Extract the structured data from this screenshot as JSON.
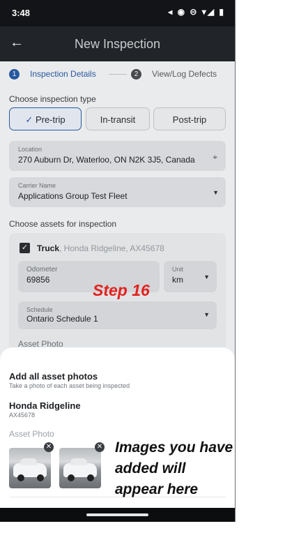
{
  "status_bar": {
    "time": "3:48",
    "icons": "◂ ◉ ⊝ ▾◢ ▮"
  },
  "app_bar": {
    "title": "New Inspection"
  },
  "stepper": {
    "step1_number": "1",
    "step1_label": "Inspection Details",
    "step2_number": "2",
    "step2_label": "View/Log Defects"
  },
  "inspection_type": {
    "label": "Choose inspection type",
    "options": [
      "Pre-trip",
      "In-transit",
      "Post-trip"
    ],
    "selected": "Pre-trip"
  },
  "location": {
    "label": "Location",
    "value": "270 Auburn Dr, Waterloo, ON N2K 3J5, Canada"
  },
  "carrier": {
    "label": "Carrier Name",
    "value": "Applications Group Test Fleet"
  },
  "assets": {
    "label": "Choose assets for inspection",
    "asset": {
      "type": "Truck",
      "details": ", Honda Ridgeline, AX45678",
      "odometer_label": "Odometer",
      "odometer_value": "69856",
      "unit_label": "Unit",
      "unit_value": "km",
      "schedule_label": "Schedule",
      "schedule_value": "Ontario Schedule 1",
      "photo_label": "Asset Photo"
    }
  },
  "annotation_step": "Step 16",
  "sheet": {
    "title": "Add all asset photos",
    "subtitle": "Take a photo of each asset being inspected",
    "asset_name": "Honda Ridgeline",
    "asset_id": "AX45678",
    "photo_label": "Asset Photo"
  },
  "callout_lines": [
    "Images you have",
    "added will",
    "appear here"
  ],
  "colors": {
    "accent": "#2a5da8",
    "annotation_red": "#e3221f",
    "appbar": "#23272c"
  }
}
